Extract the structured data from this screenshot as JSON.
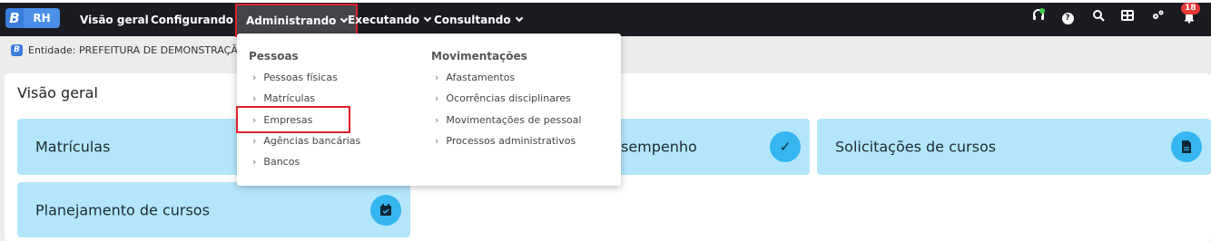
{
  "app": {
    "logo_letter": "B",
    "logo_text": "RH"
  },
  "nav": {
    "visao_geral": "Visão geral",
    "configurando": "Configurando",
    "administrando": "Administrando",
    "executando": "Executando",
    "consultando": "Consultando"
  },
  "header_icons": {
    "help": "?",
    "notifications_count": "18",
    "icons": [
      "headset-icon",
      "help-icon",
      "search-icon",
      "apps-grid-icon",
      "settings-icon",
      "bell-icon"
    ]
  },
  "entity": {
    "label": "Entidade: PREFEITURA DE DEMONSTRAÇÃO"
  },
  "main": {
    "title": "Visão geral",
    "tiles": [
      {
        "label": "Matrículas"
      },
      {
        "label": "sempenho",
        "icon": "check-icon"
      },
      {
        "label": "Solicitações de cursos",
        "icon": "document-icon"
      },
      {
        "label": "Planejamento de cursos",
        "icon": "calendar-check-icon"
      }
    ]
  },
  "dropdown": {
    "pessoas": {
      "title": "Pessoas",
      "items": [
        "Pessoas físicas",
        "Matrículas",
        "Empresas",
        "Agências bancárias",
        "Bancos"
      ]
    },
    "movimentacoes": {
      "title": "Movimentações",
      "items": [
        "Afastamentos",
        "Ocorrências disciplinares",
        "Movimentações de pessoal",
        "Processos administrativos"
      ]
    }
  },
  "colors": {
    "topbar": "#1b1b22",
    "tile": "#b3e6fb",
    "tile_icon": "#35b6f0",
    "highlight": "#e0212b"
  }
}
